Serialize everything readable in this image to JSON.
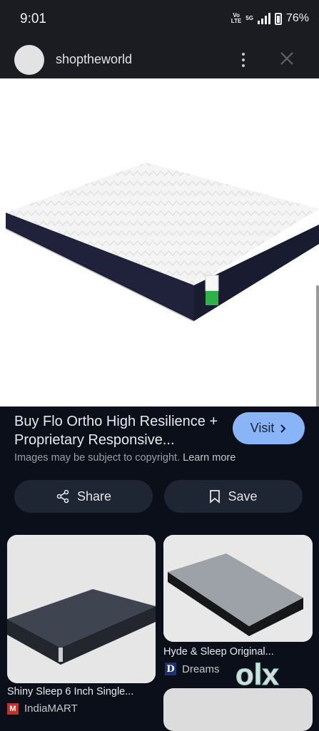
{
  "status_bar": {
    "time": "9:01",
    "volte": "Vo\nLTE",
    "network": "5G",
    "battery": "76%",
    "icons": [
      "volte-icon",
      "5g-signal-icon",
      "battery-icon"
    ]
  },
  "header": {
    "site_name": "shoptheworld",
    "icons": [
      "avatar",
      "more-vert-icon",
      "close-icon"
    ]
  },
  "product": {
    "title": "Buy Flo Ortho High Resilience + Proprietary Responsive...",
    "visit_label": "Visit",
    "copyright_text": "Images may be subject to copyright.",
    "learn_more": "Learn more"
  },
  "actions": {
    "share_label": "Share",
    "save_label": "Save"
  },
  "related": [
    {
      "title": "Shiny Sleep 6 Inch Single...",
      "source": "IndiaMART",
      "favicon": "M"
    },
    {
      "title": "Hyde & Sleep Original...",
      "source": "Dreams",
      "favicon": "D"
    }
  ],
  "watermark": "olx",
  "colors": {
    "background": "#0b0f19",
    "bar": "#1a1c22",
    "accent": "#8ab4f8",
    "button_bg": "#1e2533",
    "olx_green": "#7ed3c0"
  }
}
